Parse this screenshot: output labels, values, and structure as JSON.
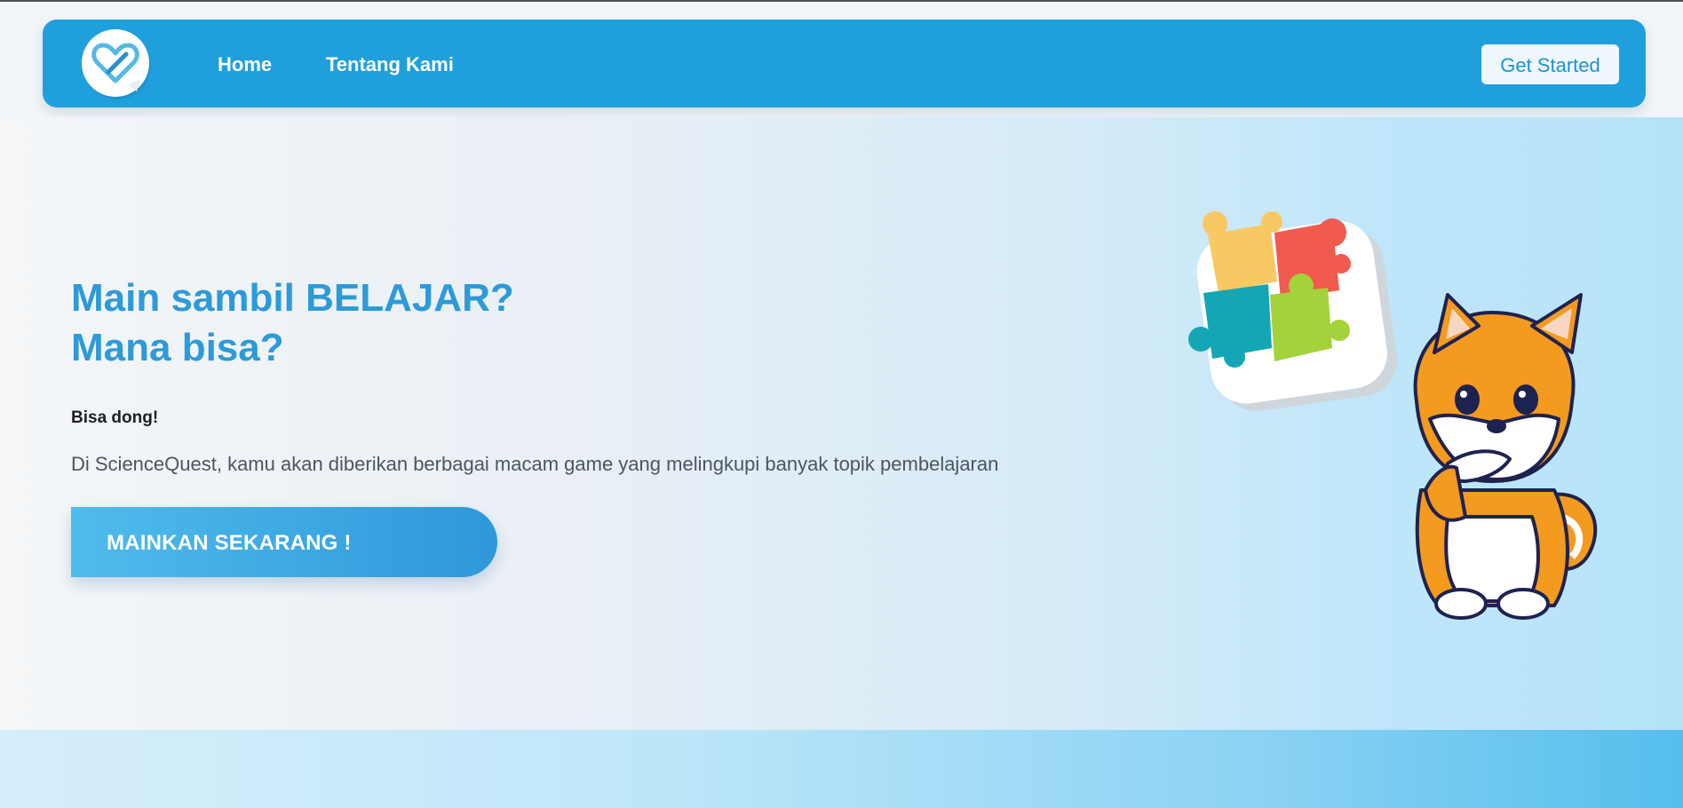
{
  "nav": {
    "logo_icon": "heart-puzzle-logo-icon",
    "links": [
      {
        "label": "Home"
      },
      {
        "label": "Tentang Kami"
      }
    ],
    "cta_label": "Get Started"
  },
  "hero": {
    "title_line1": "Main sambil BELAJAR?",
    "title_line2": "Mana bisa?",
    "subtitle": "Bisa dong!",
    "description": "Di ScienceQuest, kamu akan diberikan berbagai macam game yang melingkupi banyak topik pembelajaran",
    "cta_label": "MAINKAN SEKARANG !",
    "illustration": "thinking-shiba-puzzle-illustration"
  },
  "colors": {
    "nav_bg": "#1fa0dd",
    "title": "#2d9ad9",
    "cta_start": "#4fbcec",
    "cta_end": "#2e98da"
  }
}
